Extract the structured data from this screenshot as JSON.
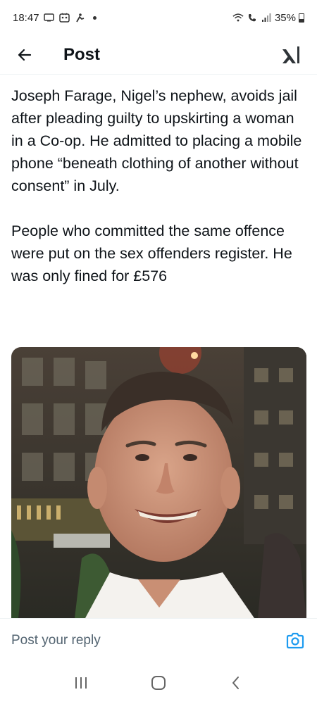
{
  "status_bar": {
    "time": "18:47",
    "battery": "35%"
  },
  "header": {
    "title": "Post"
  },
  "post": {
    "text": "Joseph Farage, Nigel’s nephew, avoids jail after pleading guilty to upskirting a woman in a  Co-op. He admitted to placing a mobile phone “beneath clothing of another without consent” in July.\n\nPeople who committed the same offence were put on the sex offenders register. He was only fined for £576"
  },
  "reply": {
    "placeholder": "Post your reply"
  },
  "colors": {
    "accent": "#1d9bf0",
    "text": "#0f1419",
    "muted": "#536471"
  }
}
